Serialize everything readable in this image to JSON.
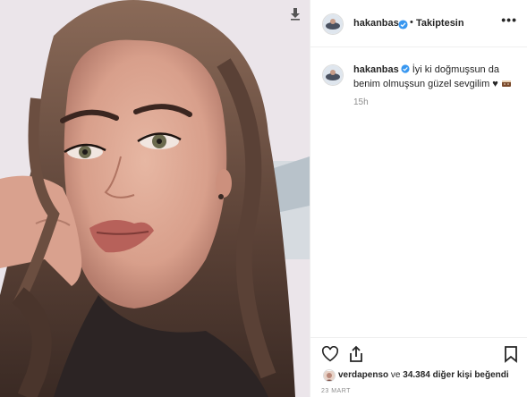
{
  "header": {
    "username": "hakanbas",
    "separator": "•",
    "follow_status": "Takiptesin",
    "more_icon": "more-horizontal-icon"
  },
  "caption": {
    "username": "hakanbas",
    "text": "İyi ki doğmuşsun da benim olmuşsun güzel sevgilim ♥",
    "emoji_icon": "cake-emoji-icon",
    "time": "15h"
  },
  "actions": {
    "like_icon": "heart-icon",
    "share_icon": "share-icon",
    "save_icon": "bookmark-icon"
  },
  "likes": {
    "first_user": "verdapenso",
    "middle": " ve ",
    "count": "34.384",
    "suffix": " diğer kişi beğendi"
  },
  "date": "23 MART",
  "photo": {
    "download_icon": "download-arrow-icon"
  },
  "colors": {
    "text": "#262626",
    "muted": "#8e8e8e",
    "verified": "#3897f0",
    "divider": "#efefef"
  }
}
